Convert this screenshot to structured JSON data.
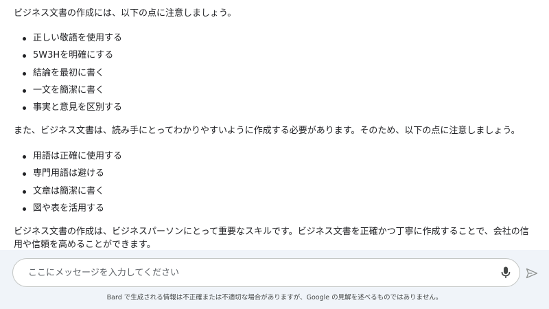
{
  "response": {
    "intro": "ビジネス文書の作成には、以下の点に注意しましょう。",
    "list1": [
      "正しい敬語を使用する",
      "5W3Hを明確にする",
      "結論を最初に書く",
      "一文を簡潔に書く",
      "事実と意見を区別する"
    ],
    "middle": "また、ビジネス文書は、読み手にとってわかりやすいように作成する必要があります。そのため、以下の点に注意しましょう。",
    "list2": [
      "用語は正確に使用する",
      "専門用語は避ける",
      "文章は簡潔に書く",
      "図や表を活用する"
    ],
    "conclusion": "ビジネス文書の作成は、ビジネスパーソンにとって重要なスキルです。ビジネス文書を正確かつ丁寧に作成することで、会社の信用や信頼を高めることができます。"
  },
  "input": {
    "placeholder": "ここにメッセージを入力してください",
    "value": ""
  },
  "icons": {
    "mic": "microphone-icon",
    "send": "send-icon"
  },
  "disclaimer": "Bard で生成される情報は不正確または不適切な場合がありますが、Google の見解を述べるものではありません。",
  "colors": {
    "text": "#202124",
    "input_area_bg": "#f0f4f9",
    "input_border": "#c4c7c5",
    "icon_active": "#444746",
    "icon_disabled": "#8e918f"
  }
}
